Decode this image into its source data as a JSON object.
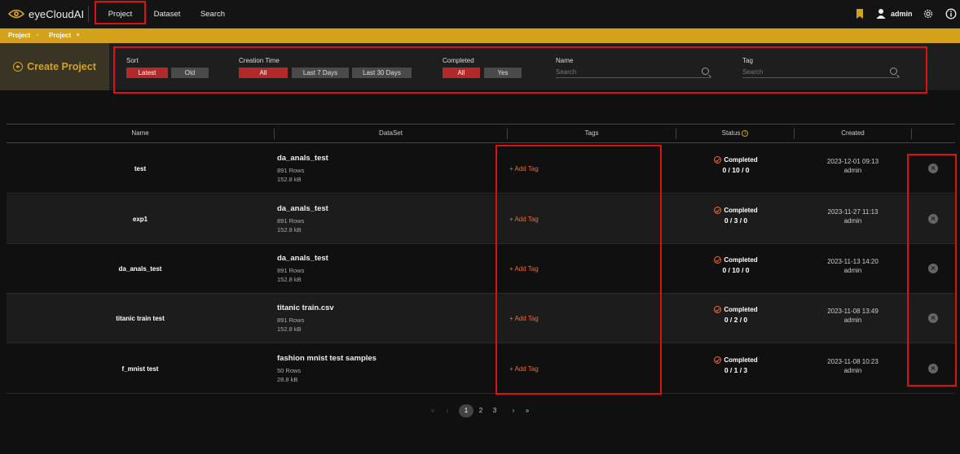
{
  "app": {
    "name": "eyeCloudAI"
  },
  "nav": {
    "project": "Project",
    "dataset": "Dataset",
    "search": "Search"
  },
  "user": {
    "name": "admin"
  },
  "breadcrumb": [
    "Project",
    "Project"
  ],
  "create_label": "Create Project",
  "filters": {
    "sort": {
      "label": "Sort",
      "options": [
        "Latest",
        "Old"
      ],
      "selected": "Latest"
    },
    "creation_time": {
      "label": "Creation Time",
      "options": [
        "All",
        "Last 7 Days",
        "Last 30 Days"
      ],
      "selected": "All"
    },
    "completed": {
      "label": "Completed",
      "options": [
        "All",
        "Yes"
      ],
      "selected": "All"
    },
    "name": {
      "label": "Name",
      "placeholder": "Search"
    },
    "tag": {
      "label": "Tag",
      "placeholder": "Search"
    }
  },
  "table": {
    "headers": {
      "name": "Name",
      "dataset": "DataSet",
      "tags": "Tags",
      "status": "Status",
      "created": "Created"
    },
    "rows": [
      {
        "name": "test",
        "dataset": "da_anals_test",
        "rows": "891 Rows",
        "size": "152.8 kB",
        "tag": "+ Add Tag",
        "status": "Completed",
        "counts": "0 / 10 / 0",
        "date": "2023-12-01 09:13",
        "user": "admin"
      },
      {
        "name": "exp1",
        "dataset": "da_anals_test",
        "rows": "891 Rows",
        "size": "152.8 kB",
        "tag": "+ Add Tag",
        "status": "Completed",
        "counts": "0 / 3 / 0",
        "date": "2023-11-27 11:13",
        "user": "admin"
      },
      {
        "name": "da_anals_test",
        "dataset": "da_anals_test",
        "rows": "891 Rows",
        "size": "152.8 kB",
        "tag": "+ Add Tag",
        "status": "Completed",
        "counts": "0 / 10 / 0",
        "date": "2023-11-13 14:20",
        "user": "admin"
      },
      {
        "name": "titanic train test",
        "dataset": "titanic train.csv",
        "rows": "891 Rows",
        "size": "152.8 kB",
        "tag": "+ Add Tag",
        "status": "Completed",
        "counts": "0 / 2 / 0",
        "date": "2023-11-08 13:49",
        "user": "admin"
      },
      {
        "name": "f_mnist test",
        "dataset": "fashion mnist test samples",
        "rows": "50 Rows",
        "size": "28.8 kB",
        "tag": "+ Add Tag",
        "status": "Completed",
        "counts": "0 / 1 / 3",
        "date": "2023-11-08 10:23",
        "user": "admin"
      }
    ]
  },
  "pagination": {
    "first": "«",
    "prev": "‹",
    "pages": [
      "1",
      "2",
      "3"
    ],
    "current": "1",
    "next": "›",
    "last": "»"
  },
  "colors": {
    "accent": "#d4a21a",
    "active_filter": "#b32828",
    "tag_link": "#ef6a3a",
    "highlight_box": "#e01010"
  }
}
